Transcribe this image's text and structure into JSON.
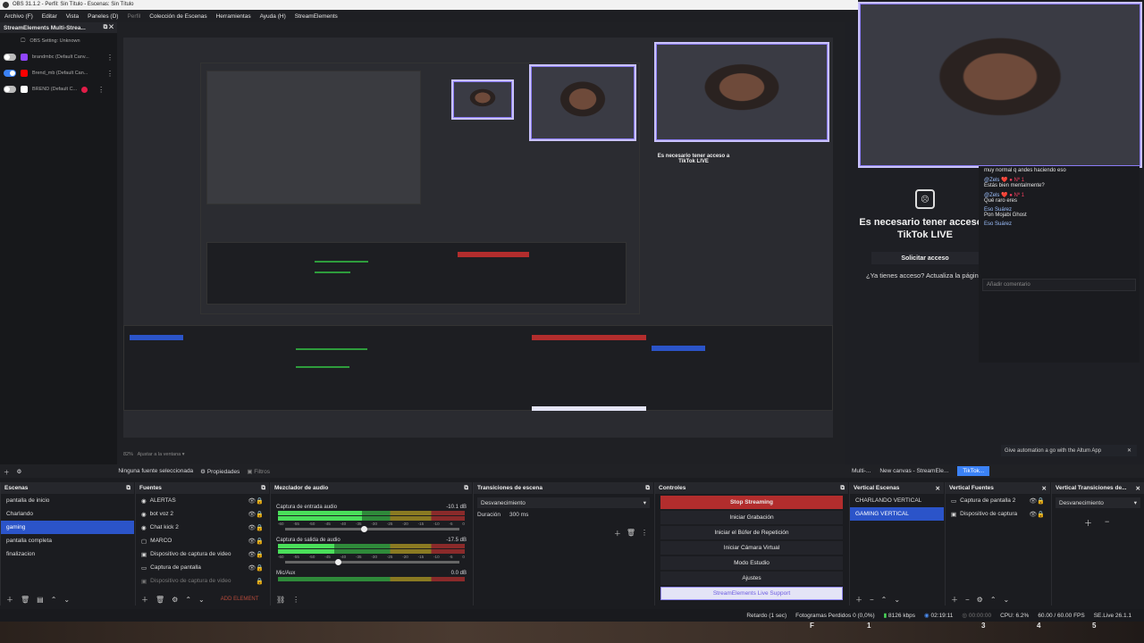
{
  "window": {
    "title": "OBS 31.1.2 - Perfil: Sin Título - Escenas: Sin Título"
  },
  "menu": [
    "Archivo (F)",
    "Editar",
    "Vista",
    "Paneles (D)",
    "Perfil",
    "Colección de Escenas",
    "Herramientas",
    "Ayuda (H)",
    "StreamElements"
  ],
  "multistream": {
    "title": "StreamElements Multi-Strea...",
    "accounts": [
      {
        "name": "OBS Setting: Unknown",
        "enabled": false,
        "color": "#555555"
      },
      {
        "name": "brandmbc (Default Canv...",
        "enabled": false,
        "color": "#9146ff"
      },
      {
        "name": "Brend_mb (Default Can...",
        "enabled": true,
        "color": "#ff0000"
      },
      {
        "name": "BREND (Default C...",
        "enabled": false,
        "color": "#ffffff"
      }
    ]
  },
  "preview": {
    "zoom": "82%",
    "fit_label": "Ajustar a la ventana"
  },
  "tiktok": {
    "needs_access": "Es necesario tener acceso a TikTok LIVE",
    "request_button": "Solicitar acceso",
    "have_access": "¿Ya tienes acceso? Actualiza la página.",
    "comment_placeholder": "Añadir comentario",
    "automation": "Give automation a go with the Altum App"
  },
  "chat": [
    {
      "name": "",
      "text": "muy normal q andes haciendo eso"
    },
    {
      "name": "@Zels ❤️",
      "text": "Estás bien mentalmente?"
    },
    {
      "name": "@Zels ❤️",
      "text": "Qué raro eres"
    },
    {
      "name": "Eso Suárez",
      "text": "Pon Mojabi Ghost"
    },
    {
      "name": "Eso Suárez",
      "text": ""
    }
  ],
  "source_toolbar": {
    "no_source": "Ninguna fuente seleccionada",
    "properties": "Propiedades",
    "filters": "Filtros"
  },
  "right_tabs": [
    "Multi-...",
    "New canvas - StreamEle...",
    "TikTok..."
  ],
  "scenes": {
    "title": "Escenas",
    "items": [
      "pantalla de inicio",
      "Charlando",
      "gaming",
      "pantalla completa",
      "finalizacion"
    ],
    "selected": 2
  },
  "sources": {
    "title": "Fuentes",
    "items": [
      "ALERTAS",
      "bot voz 2",
      "Chat kick 2",
      "MARCO",
      "Dispositivo de captura de video",
      "Captura de pantalla",
      "Dispositivo de captura de video"
    ],
    "add_element": "ADD ELEMENT"
  },
  "mixer": {
    "title": "Mezclador de audio",
    "channels": [
      {
        "name": "Captura de entrada audio",
        "db": "-10.1 dB",
        "level": 0.45
      },
      {
        "name": "Captura de salida de audio",
        "db": "-17.5 dB",
        "level": 0.3
      },
      {
        "name": "Mic/Aux",
        "db": "0.0 dB",
        "level": 0.0
      }
    ],
    "scale": [
      "-60",
      "-55",
      "-50",
      "-45",
      "-40",
      "-35",
      "-30",
      "-25",
      "-20",
      "-15",
      "-10",
      "-5",
      "0"
    ]
  },
  "transitions": {
    "title": "Transiciones de escena",
    "type": "Desvanecimiento",
    "duration_label": "Duración",
    "duration": "300 ms"
  },
  "controls": {
    "title": "Controles",
    "buttons": [
      "Stop Streaming",
      "Iniciar Grabación",
      "Iniciar el Búfer de Repetición",
      "Iniciar Cámara Virtual",
      "Modo Estudio",
      "Ajustes",
      "StreamElements Live Support"
    ]
  },
  "vertical_scenes": {
    "title": "Vertical Escenas",
    "items": [
      "CHARLANDO VERTICAL",
      "GAMING VERTICAL"
    ],
    "selected": 1
  },
  "vertical_sources": {
    "title": "Vertical Fuentes",
    "items": [
      "Captura de pantalla 2",
      "Dispositivo de captura"
    ]
  },
  "vertical_transitions": {
    "title": "Vertical Transiciones de...",
    "type": "Desvanecimiento"
  },
  "status": {
    "delay": "Retardo (1 sec)",
    "dropped": "Fotogramas Perdidos 0 (0,0%)",
    "bitrate": "8126 kbps",
    "stream_time": "02:19:11",
    "rec_time": "00:00:00",
    "cpu": "CPU: 6.2%",
    "fps": "60.00 / 60.00 FPS",
    "version": "SE.Live 26.1.1"
  },
  "keyboard_row": [
    "F",
    "1",
    "3",
    "4",
    "5"
  ],
  "colors": {
    "accent": "#2b54c9",
    "stop": "#b22d2d",
    "tiktok": "#3b82f6"
  }
}
